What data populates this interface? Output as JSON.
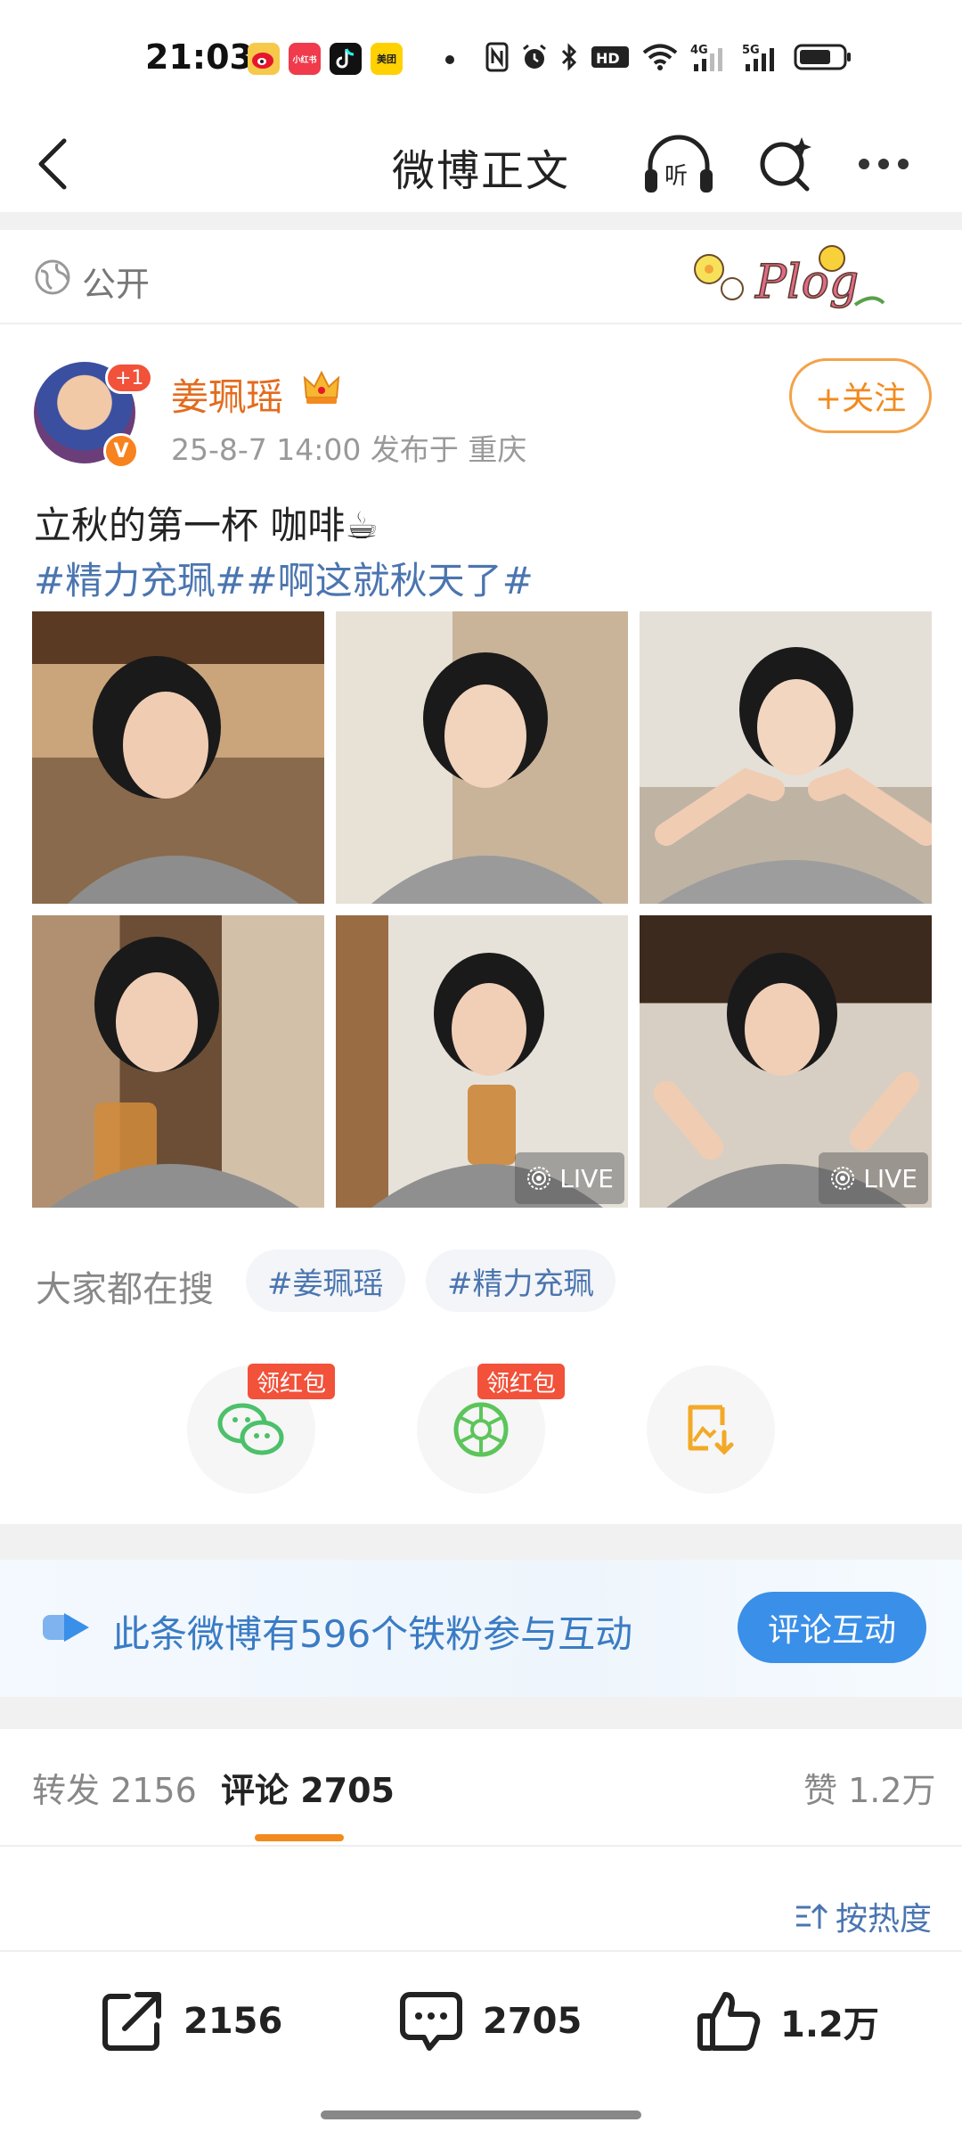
{
  "status_bar": {
    "time": "21:03",
    "apps": [
      {
        "icon": "weibo-icon",
        "color": "#f6c94a"
      },
      {
        "icon": "xiaohongshu-icon",
        "color": "#ef3b4c",
        "text": "小红书"
      },
      {
        "icon": "tiktok-icon",
        "color": "#111111"
      },
      {
        "icon": "meituan-icon",
        "color": "#ffd100",
        "text": "美团"
      }
    ],
    "indicators": [
      "nfc-icon",
      "alarm-icon",
      "bluetooth-icon",
      "hd-icon",
      "wifi-icon",
      "signal-4g-icon",
      "signal-5g-icon",
      "battery-icon"
    ]
  },
  "nav": {
    "title": "微博正文",
    "listen_label": "听"
  },
  "visibility": {
    "label": "公开",
    "sticker_text": "Plog"
  },
  "author": {
    "name": "姜珮瑶",
    "plus_badge": "+1",
    "verified_mark": "V",
    "meta": "25-8-7 14:00   发布于 重庆",
    "follow_label": "+关注"
  },
  "post": {
    "text": "立秋的第一杯 咖啡☕",
    "tags": "#精力充珮##啊这就秋天了#",
    "photos": [
      {
        "live": false
      },
      {
        "live": false
      },
      {
        "live": false
      },
      {
        "live": false
      },
      {
        "live": true,
        "live_label": "LIVE"
      },
      {
        "live": true,
        "live_label": "LIVE"
      }
    ]
  },
  "hot_search": {
    "label": "大家都在搜",
    "chips": [
      "#姜珮瑶",
      "#精力充珮"
    ]
  },
  "share": {
    "red_tag": "领红包",
    "items": [
      {
        "icon": "wechat-icon",
        "color": "#4cc06a"
      },
      {
        "icon": "moments-icon",
        "color": "#5cc55a"
      },
      {
        "icon": "save-image-icon",
        "color": "#f3a927"
      }
    ]
  },
  "fans_banner": {
    "text": "此条微博有596个铁粉参与互动",
    "button": "评论互动"
  },
  "tabs": {
    "repost": "转发 2156",
    "comments": "评论 2705",
    "likes": "赞 1.2万"
  },
  "sort_label": "按热度",
  "bottom_bar": {
    "repost_count": "2156",
    "comment_count": "2705",
    "like_count": "1.2万"
  },
  "colors": {
    "accent_orange": "#f28a1d",
    "link_blue": "#4b75b0",
    "button_blue": "#3a8fe8"
  }
}
